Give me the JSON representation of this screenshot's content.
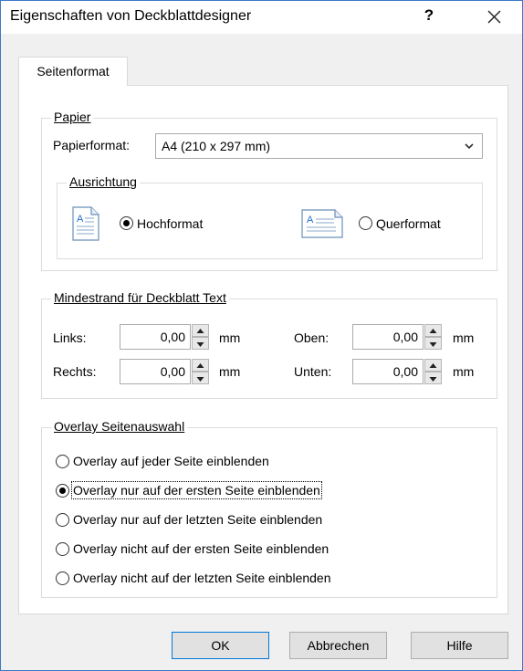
{
  "window": {
    "title": "Eigenschaften von Deckblattdesigner",
    "help_label": "?"
  },
  "tabs": [
    {
      "label": "Seitenformat"
    }
  ],
  "papier": {
    "group_label": "Papier",
    "papierformat_label": "Papierformat:",
    "papierformat_value": "A4 (210 x 297 mm)",
    "ausrichtung": {
      "group_label": "Ausrichtung",
      "options": [
        {
          "label": "Hochformat",
          "checked": true,
          "icon": "portrait-page-icon"
        },
        {
          "label": "Querformat",
          "checked": false,
          "icon": "landscape-page-icon"
        }
      ]
    }
  },
  "mindestrand": {
    "group_label": "Mindestrand für Deckblatt Text",
    "fields": {
      "links": {
        "label": "Links:",
        "value": "0,00",
        "unit": "mm"
      },
      "rechts": {
        "label": "Rechts:",
        "value": "0,00",
        "unit": "mm"
      },
      "oben": {
        "label": "Oben:",
        "value": "0,00",
        "unit": "mm"
      },
      "unten": {
        "label": "Unten:",
        "value": "0,00",
        "unit": "mm"
      }
    }
  },
  "overlay": {
    "group_label": "Overlay Seitenauswahl",
    "options": [
      {
        "label": "Overlay auf jeder Seite einblenden",
        "checked": false
      },
      {
        "label": "Overlay nur auf der ersten Seite einblenden",
        "checked": true
      },
      {
        "label": "Overlay nur auf der letzten Seite einblenden",
        "checked": false
      },
      {
        "label": "Overlay nicht auf der ersten Seite einblenden",
        "checked": false
      },
      {
        "label": "Overlay nicht auf der letzten Seite einblenden",
        "checked": false
      }
    ]
  },
  "buttons": {
    "ok": "OK",
    "cancel": "Abbrechen",
    "help": "Hilfe"
  },
  "colors": {
    "accent": "#0078d7",
    "border": "#3d79c7"
  }
}
